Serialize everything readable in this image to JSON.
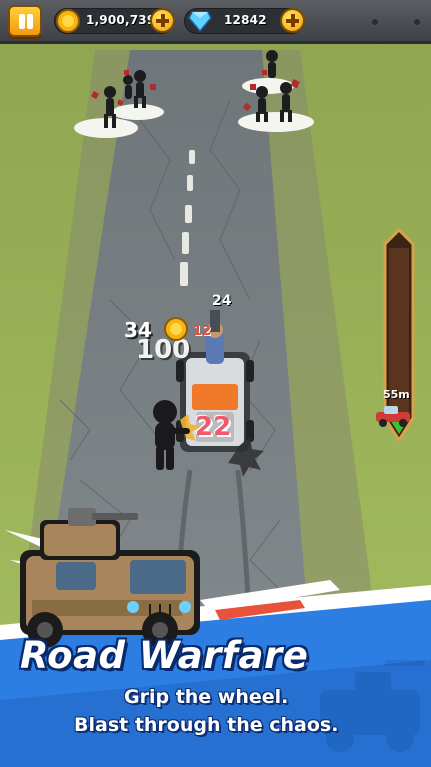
{
  "hud": {
    "coins": "1,900,739",
    "gems": "12842",
    "distance": "55m"
  },
  "combat": {
    "coin_reward": "34",
    "reward_large": "100",
    "damage_enemy": "24",
    "damage_small": "12",
    "damage_big": "22"
  },
  "banner": {
    "title": "Road Warfare",
    "line1": "Grip the wheel.",
    "line2": "Blast through the chaos."
  },
  "colors": {
    "grass": "#9cb35a",
    "road": "#7c8386",
    "banner_blue": "#2d7ee3",
    "accent_gold": "#f7b20f"
  },
  "icons": [
    "pause-icon",
    "coin-icon",
    "gem-icon",
    "plus-icon",
    "car-marker-icon"
  ]
}
